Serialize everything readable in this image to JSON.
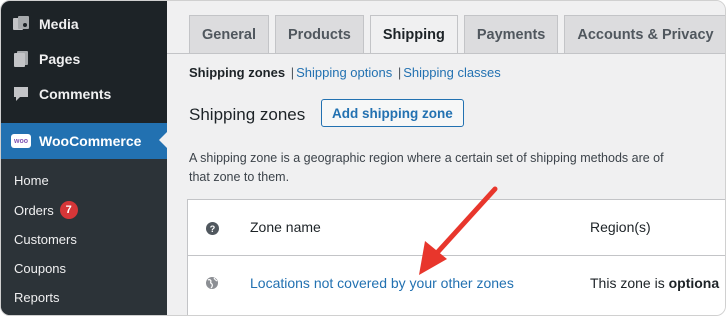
{
  "sidebar": {
    "items": [
      {
        "label": "Media",
        "icon": "media-icon"
      },
      {
        "label": "Pages",
        "icon": "pages-icon"
      },
      {
        "label": "Comments",
        "icon": "comments-icon"
      },
      {
        "label": "WooCommerce",
        "icon": "woocommerce-icon",
        "logo_text": "woo"
      }
    ],
    "submenu": [
      {
        "label": "Home"
      },
      {
        "label": "Orders",
        "badge": "7"
      },
      {
        "label": "Customers"
      },
      {
        "label": "Coupons"
      },
      {
        "label": "Reports"
      }
    ]
  },
  "tabs": [
    {
      "label": "General",
      "active": false
    },
    {
      "label": "Products",
      "active": false
    },
    {
      "label": "Shipping",
      "active": true
    },
    {
      "label": "Payments",
      "active": false
    },
    {
      "label": "Accounts & Privacy",
      "active": false
    }
  ],
  "subsub": {
    "current": "Shipping zones",
    "links": [
      "Shipping options",
      "Shipping classes"
    ],
    "separator": "|"
  },
  "section": {
    "heading": "Shipping zones",
    "add_button": "Add shipping zone",
    "description_line1": "A shipping zone is a geographic region where a certain set of shipping methods are of",
    "description_line2": "that zone to them."
  },
  "table": {
    "header_icon": "?",
    "col_zone_name": "Zone name",
    "col_regions": "Region(s)",
    "row_zone_name": "Locations not covered by your other zones",
    "row_region_prefix": "This zone is ",
    "row_region_bold": "optiona"
  },
  "colors": {
    "sidebar_bg": "#1d2327",
    "submenu_bg": "#2c3338",
    "accent": "#2271b1",
    "badge": "#d63638",
    "annotation_arrow": "#e8362c"
  }
}
